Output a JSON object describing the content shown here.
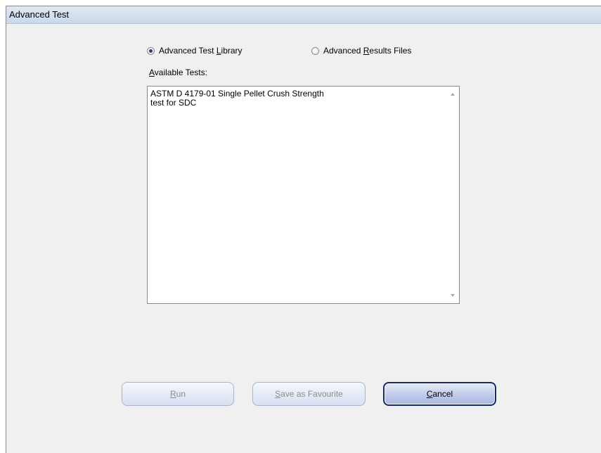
{
  "window": {
    "title": "Advanced Test"
  },
  "source_options": [
    {
      "label_prefix": "Advanced Test ",
      "label_access": "L",
      "label_suffix": "ibrary",
      "checked": true
    },
    {
      "label_prefix": "Advanced ",
      "label_access": "R",
      "label_suffix": "esults Files",
      "checked": false
    }
  ],
  "available_tests": {
    "label_access": "A",
    "label_suffix": "vailable Tests:",
    "items": [
      "ASTM D 4179-01 Single Pellet Crush Strength",
      "test for SDC"
    ]
  },
  "buttons": {
    "run": {
      "access": "R",
      "suffix": "un",
      "enabled": false
    },
    "save_favourite": {
      "access": "S",
      "suffix": "ave as Favourite",
      "enabled": false
    },
    "cancel": {
      "access": "C",
      "suffix": "ancel",
      "enabled": true
    }
  },
  "icons": {
    "scroll_up": "scroll-up-arrow",
    "scroll_down": "scroll-down-arrow"
  }
}
